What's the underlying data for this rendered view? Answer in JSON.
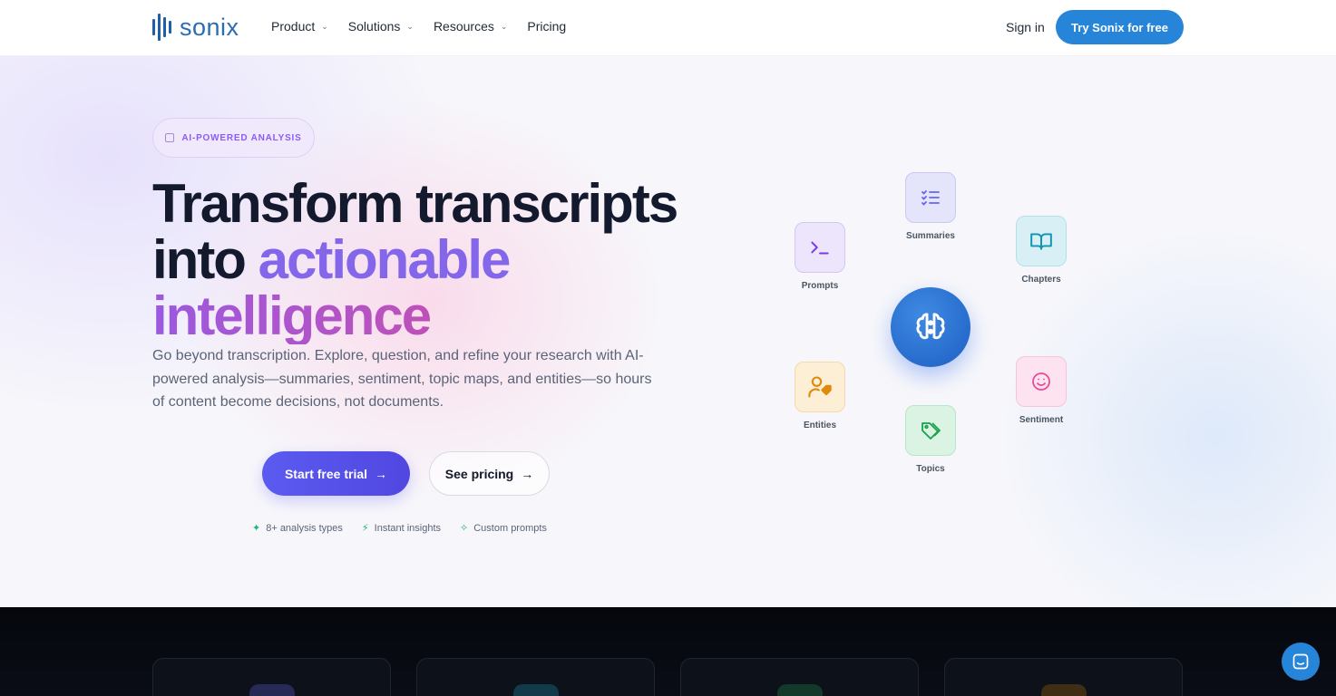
{
  "nav": {
    "logo_text": "sonix",
    "menu": [
      {
        "label": "Product",
        "has_dropdown": true
      },
      {
        "label": "Solutions",
        "has_dropdown": true
      },
      {
        "label": "Resources",
        "has_dropdown": true
      },
      {
        "label": "Pricing",
        "has_dropdown": false
      }
    ],
    "signin": "Sign in",
    "cta": "Try Sonix for free"
  },
  "hero": {
    "badge": "AI-POWERED ANALYSIS",
    "headline": {
      "line1": "Transform transcripts",
      "line2_plain": "into ",
      "line2_accent": "actionable",
      "line3_accent": "intelligence"
    },
    "subtext": "Go beyond transcription. Explore, question, and refine your research with AI-powered analysis—summaries, sentiment, topic maps, and entities—so hours of content become decisions, not documents.",
    "cta_primary": "Start free trial",
    "cta_secondary": "See pricing",
    "features": [
      {
        "icon": "sparkle-icon",
        "label": "8+ analysis types"
      },
      {
        "icon": "lightning-icon",
        "label": "Instant insights"
      },
      {
        "icon": "magic-wand-icon",
        "label": "Custom prompts"
      }
    ]
  },
  "diagram": {
    "center_icon": "brain-icon",
    "nodes": [
      {
        "label": "Summaries",
        "icon": "checklist-icon",
        "color": "#6366f1"
      },
      {
        "label": "Prompts",
        "icon": "terminal-icon",
        "color": "#7c3aed"
      },
      {
        "label": "Chapters",
        "icon": "book-icon",
        "color": "#0e94b0"
      },
      {
        "label": "Entities",
        "icon": "user-tag-icon",
        "color": "#e08a0b"
      },
      {
        "label": "Sentiment",
        "icon": "smile-icon",
        "color": "#ec4899"
      },
      {
        "label": "Topics",
        "icon": "tag-icon",
        "color": "#16a34a"
      }
    ]
  },
  "colors": {
    "brand_blue": "#2684d9",
    "primary_purple": "#5b5bf0",
    "headline_dark": "#141a2e"
  }
}
